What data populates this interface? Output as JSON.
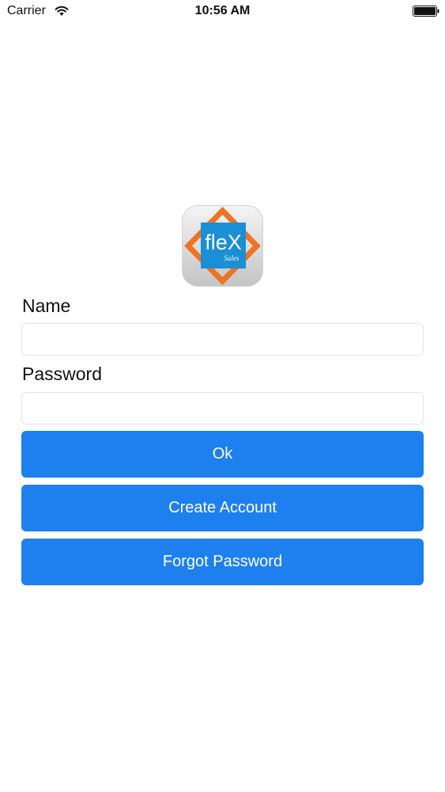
{
  "status_bar": {
    "carrier": "Carrier",
    "time": "10:56 AM",
    "wifi_icon": "wifi-icon",
    "battery_icon": "battery-full-icon"
  },
  "logo": {
    "word": "fleX",
    "sub": "Sales",
    "colors": {
      "tile": "#1a8fd6",
      "diamond": "#ee7322",
      "frame": "#c9c9c9"
    }
  },
  "form": {
    "name_label": "Name",
    "name_value": "",
    "password_label": "Password",
    "password_value": ""
  },
  "buttons": {
    "ok": "Ok",
    "create_account": "Create Account",
    "forgot_password": "Forgot Password"
  },
  "colors": {
    "accent": "#1e80ee",
    "field_border": "#e7e1e5"
  }
}
